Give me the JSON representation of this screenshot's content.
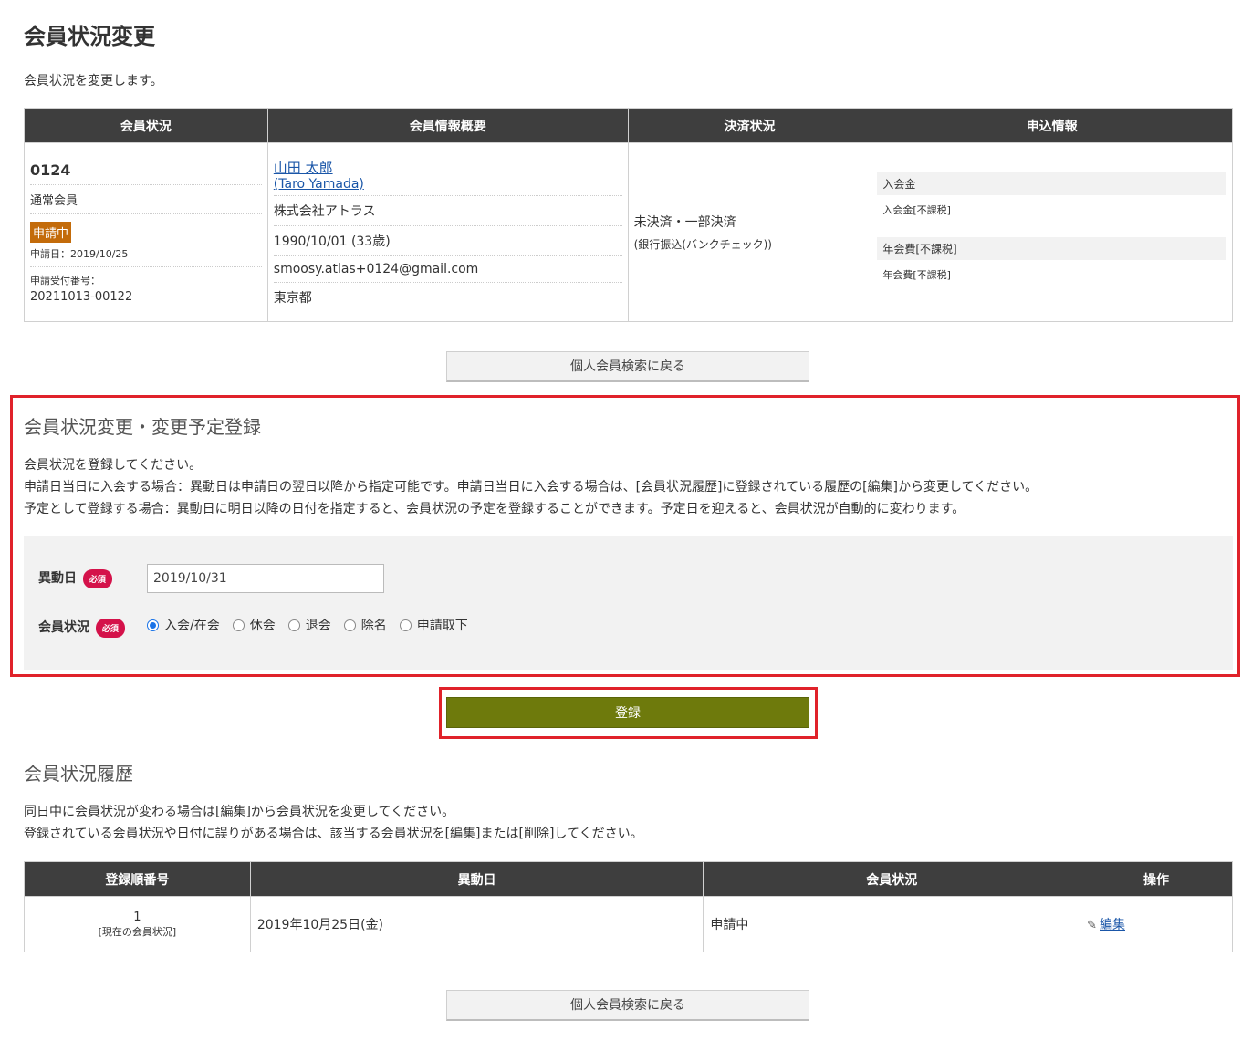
{
  "page": {
    "title": "会員状況変更",
    "description": "会員状況を変更します。"
  },
  "info_table": {
    "headers": [
      "会員状況",
      "会員情報概要",
      "決済状況",
      "申込情報"
    ],
    "member_status": {
      "number": "0124",
      "type": "通常会員",
      "badge": "申請中",
      "apply_date": "申請日：2019/10/25",
      "apply_no_label": "申請受付番号：",
      "apply_no": "20211013-00122"
    },
    "member_info": {
      "name": "山田 太郎",
      "name_roman": "(Taro Yamada)",
      "company": "株式会社アトラス",
      "birth": "1990/10/01 (33歳)",
      "email": "smoosy.atlas+0124@gmail.com",
      "pref": "東京都"
    },
    "payment": {
      "status": "未決済・一部決済",
      "method": "(銀行振込(バンクチェック))"
    },
    "application": [
      {
        "label": "入会金",
        "value": "入会金[不課税]"
      },
      {
        "label": "年会費[不課税]",
        "value": "年会費[不課税]"
      }
    ]
  },
  "back_button_label": "個人会員検索に戻る",
  "change_section": {
    "title": "会員状況変更・変更予定登録",
    "desc1": "会員状況を登録してください。",
    "desc2": "申請日当日に入会する場合：異動日は申請日の翌日以降から指定可能です。申請日当日に入会する場合は、[会員状況履歴]に登録されている履歴の[編集]から変更してください。",
    "desc3": "予定として登録する場合：異動日に明日以降の日付を指定すると、会員状況の予定を登録することができます。予定日を迎えると、会員状況が自動的に変わります。",
    "date_label": "異動日",
    "status_label": "会員状況",
    "required": "必須",
    "date_value": "2019/10/31",
    "options": [
      "入会/在会",
      "休会",
      "退会",
      "除名",
      "申請取下"
    ],
    "selected": "入会/在会",
    "submit_label": "登録"
  },
  "history": {
    "title": "会員状況履歴",
    "desc1": "同日中に会員状況が変わる場合は[編集]から会員状況を変更してください。",
    "desc2": "登録されている会員状況や日付に誤りがある場合は、該当する会員状況を[編集]または[削除]してください。",
    "headers": [
      "登録順番号",
      "異動日",
      "会員状況",
      "操作"
    ],
    "rows": [
      {
        "no": "1",
        "current": "[現在の会員状況]",
        "date": "2019年10月25日(金)",
        "status": "申請中",
        "action": "編集"
      }
    ]
  },
  "colors": {
    "header_bg": "#3e3e3e",
    "badge": "#c36b0a",
    "required": "#d4124a",
    "submit": "#6e7a0c",
    "highlight": "#e0222a",
    "link": "#1a56a8"
  }
}
